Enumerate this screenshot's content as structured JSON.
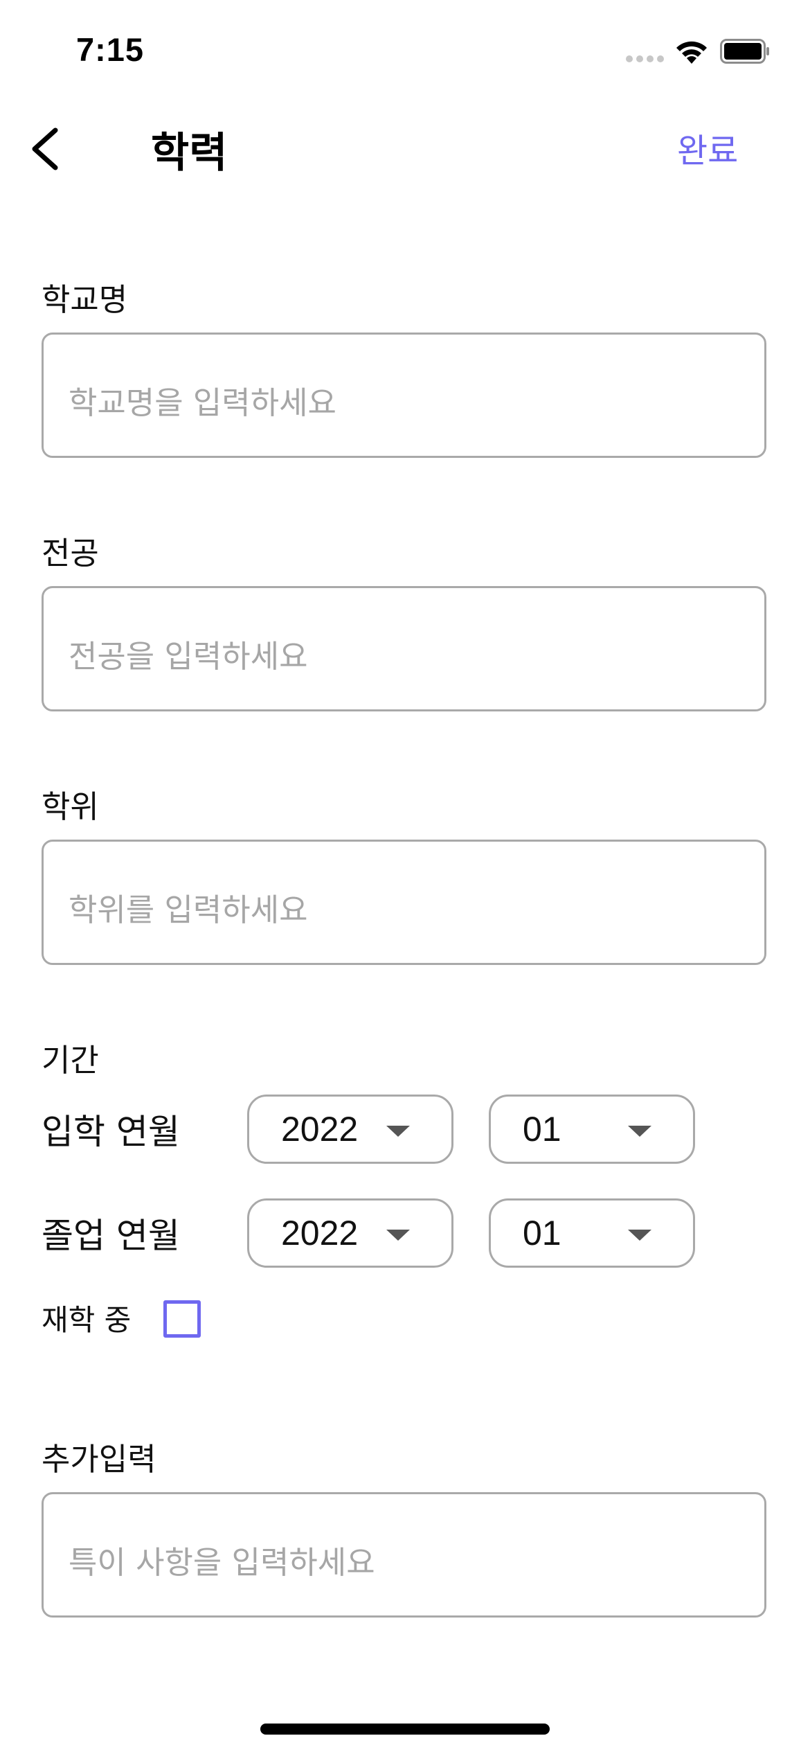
{
  "status_bar": {
    "time": "7:15",
    "icons": [
      "signal-dots-icon",
      "wifi-icon",
      "battery-icon"
    ]
  },
  "nav": {
    "back_icon": "chevron-left-icon",
    "title": "학력",
    "done_label": "완료"
  },
  "form": {
    "school": {
      "label": "학교명",
      "placeholder": "학교명을 입력하세요",
      "value": ""
    },
    "major": {
      "label": "전공",
      "placeholder": "전공을 입력하세요",
      "value": ""
    },
    "degree": {
      "label": "학위",
      "placeholder": "학위를 입력하세요",
      "value": ""
    },
    "period": {
      "label": "기간",
      "admission": {
        "label": "입학 연월",
        "year": "2022",
        "month": "01"
      },
      "graduation": {
        "label": "졸업 연월",
        "year": "2022",
        "month": "01"
      },
      "enrolled": {
        "label": "재학 중",
        "checked": false
      }
    },
    "extra": {
      "label": "추가입력",
      "placeholder": "특이 사항을 입력하세요",
      "value": ""
    }
  },
  "colors": {
    "accent": "#6f68f0",
    "border": "#a9a9a9",
    "placeholder": "#a6a6a6"
  }
}
